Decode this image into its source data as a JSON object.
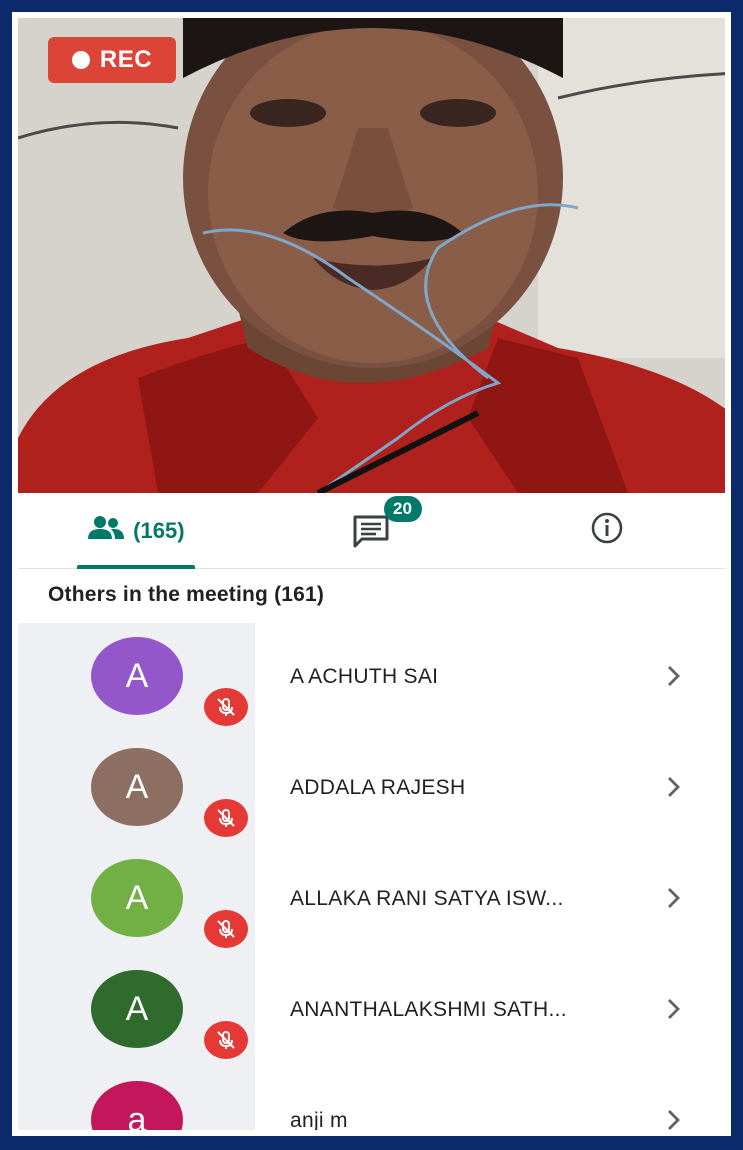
{
  "recording": {
    "label": "REC"
  },
  "tabs": {
    "people_count": "(165)",
    "chat_badge": "20"
  },
  "section": {
    "heading": "Others in the meeting (161)"
  },
  "participants": [
    {
      "initial": "A",
      "name": "A ACHUTH SAI",
      "color": "#9457c9",
      "muted": true
    },
    {
      "initial": "A",
      "name": "ADDALA RAJESH",
      "color": "#8d6e63",
      "muted": true
    },
    {
      "initial": "A",
      "name": "ALLAKA RANI SATYA ISW...",
      "color": "#72b045",
      "muted": true
    },
    {
      "initial": "A",
      "name": "ANANTHALAKSHMI SATH...",
      "color": "#2f6b2c",
      "muted": true
    },
    {
      "initial": "a",
      "name": "anji m",
      "color": "#c2185b",
      "muted": true
    }
  ],
  "colors": {
    "accent": "#00796b",
    "rec": "#db4437",
    "mute": "#e53935",
    "frame": "#0b2a6b"
  },
  "icons": {
    "people": "people-icon",
    "chat": "chat-icon",
    "info": "info-icon",
    "mic_off": "mic-off-icon",
    "chevron": "chevron-right-icon"
  }
}
